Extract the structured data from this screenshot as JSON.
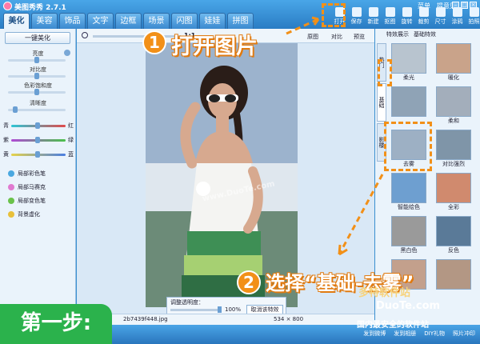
{
  "app": {
    "title": "美图秀秀 2.7.1"
  },
  "tabs": [
    "美化",
    "美容",
    "饰品",
    "文字",
    "边框",
    "场景",
    "闪图",
    "娃娃",
    "拼图"
  ],
  "top_links": [
    "菜单",
    "提意见"
  ],
  "toolbar": [
    "打开",
    "保存",
    "新建",
    "抠图",
    "旋转",
    "裁剪",
    "尺寸",
    "涂鸦",
    "拍照"
  ],
  "left_panel": {
    "one_click": "一键美化",
    "adjustments": [
      "亮度",
      "对比度",
      "色彩饱和度",
      "清晰度"
    ],
    "color_rows": [
      {
        "left": "青",
        "right": "红"
      },
      {
        "left": "紫",
        "right": "绿"
      },
      {
        "left": "黄",
        "right": "蓝"
      }
    ],
    "local_tools": [
      "局部彩色笔",
      "局部马赛克",
      "局部变色笔",
      "背景虚化"
    ]
  },
  "canvas": {
    "zoom": "1:1",
    "view_options": [
      "原图",
      "对比",
      "预览"
    ],
    "opacity_label": "调整透明度：",
    "opacity_value": "100%",
    "opacity_level": 1.0,
    "cancel_effect": "取消该特效",
    "filename": "2b7439f448.jpg",
    "size": "534 × 800",
    "watermark": "www.DuoTe.com"
  },
  "right_panel": {
    "effect_tabs": [
      "特效展示",
      "基础特效"
    ],
    "category_tabs": [
      "热门",
      "基础",
      "影楼"
    ],
    "thumbnails": [
      "柔光",
      "暖化",
      "",
      "柔和",
      "去雾",
      "对比强烈",
      "智能绘色",
      "全彩",
      "黑白色",
      "反色",
      "",
      ""
    ]
  },
  "bottom_bar": [
    "发到微博",
    "发到相册",
    "DIY礼物",
    "照片冲印"
  ],
  "annotations": {
    "step1_number": "1",
    "step1_text": "打开图片",
    "step2_number": "2",
    "step2_text": "选择“基础-去雾”",
    "first_step": "第一步:",
    "site_watermark_1": "多特软件站",
    "site_watermark_2": "DuoTe.com",
    "site_watermark_3": "国内最安全的软件站"
  },
  "colors": {
    "accent_orange": "#f29018",
    "title_blue": "#2a7cc4",
    "step_green": "#2bb24c"
  }
}
